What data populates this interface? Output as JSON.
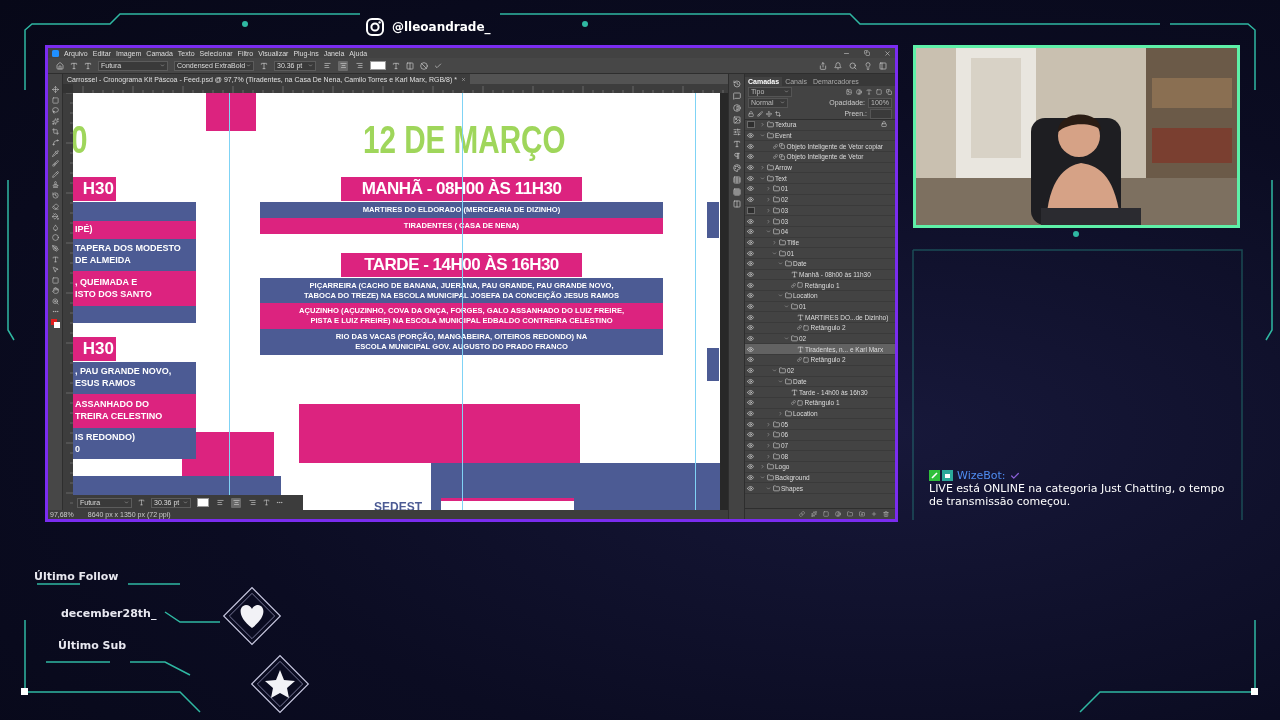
{
  "overlay": {
    "handle": "@lleoandrade_",
    "last_follow_label": "Último Follow",
    "last_follow": "december28th_",
    "last_sub_label": "Último Sub"
  },
  "photoshop": {
    "menu": [
      "Arquivo",
      "Editar",
      "Imagem",
      "Camada",
      "Texto",
      "Selecionar",
      "Filtro",
      "Visualizar",
      "Plug-ins",
      "Janela",
      "Ajuda"
    ],
    "options": {
      "font": "Futura",
      "style": "Condensed ExtraBold",
      "size": "30.36 pt",
      "alignment": [
        {
          "kind": "left",
          "selected": false
        },
        {
          "kind": "center",
          "selected": true
        },
        {
          "kind": "right",
          "selected": false
        }
      ]
    },
    "document_tab": "Carrossel - Cronograma Kit Páscoa - Feed.psd @ 97,7% (Tiradentes, na Casa De Nena, Camilo Torres e Karl Marx, RGB/8) *",
    "text_toolbar": {
      "font": "Futura",
      "size": "30.36 pt",
      "alignment": [
        {
          "kind": "left",
          "selected": false
        },
        {
          "kind": "center",
          "selected": true
        },
        {
          "kind": "right",
          "selected": false
        }
      ]
    },
    "status": {
      "zoom": "97,68%",
      "size": "8640 px x 1350 px (72 ppi)"
    },
    "panel_tabs": [
      {
        "label": "Camadas",
        "selected": true
      },
      {
        "label": "Canais",
        "selected": false
      },
      {
        "label": "Demarcadores",
        "selected": false
      }
    ],
    "layer_filter": "Tipo",
    "blend_mode": "Normal",
    "opacity_label": "Opacidade:",
    "opacity": "100%",
    "fill_label": "Preen.:",
    "layers": [
      {
        "name": "Textura",
        "kind": "folder",
        "visible": false,
        "locked": true,
        "selected": false,
        "expanded": false
      },
      {
        "name": "Event",
        "kind": "folder",
        "visible": true,
        "locked": false,
        "selected": false,
        "expanded": true,
        "children": [
          {
            "name": "Objeto Inteligente de Vetor copiar",
            "kind": "smart",
            "visible": true,
            "locked": false,
            "selected": false
          },
          {
            "name": "Objeto Inteligente de Vetor",
            "kind": "smart",
            "visible": true,
            "locked": false,
            "selected": false
          }
        ]
      },
      {
        "name": "Arrow",
        "kind": "folder",
        "visible": true,
        "locked": false,
        "selected": false,
        "expanded": false
      },
      {
        "name": "Text",
        "kind": "folder",
        "visible": true,
        "locked": false,
        "selected": false,
        "expanded": true,
        "children": [
          {
            "name": "01",
            "kind": "folder",
            "visible": true,
            "locked": false,
            "selected": false,
            "expanded": false
          },
          {
            "name": "02",
            "kind": "folder",
            "visible": true,
            "locked": false,
            "selected": false,
            "expanded": false
          },
          {
            "name": "03",
            "kind": "folder",
            "visible": false,
            "locked": false,
            "selected": false,
            "expanded": false
          },
          {
            "name": "03",
            "kind": "folder",
            "visible": true,
            "locked": false,
            "selected": false,
            "expanded": false
          },
          {
            "name": "04",
            "kind": "folder",
            "visible": true,
            "locked": false,
            "selected": false,
            "expanded": true,
            "children": [
              {
                "name": "Title",
                "kind": "folder",
                "visible": true,
                "locked": false,
                "selected": false,
                "expanded": false
              },
              {
                "name": "01",
                "kind": "folder",
                "visible": true,
                "locked": false,
                "selected": false,
                "expanded": true,
                "children": [
                  {
                    "name": "Date",
                    "kind": "folder",
                    "visible": true,
                    "locked": false,
                    "selected": false,
                    "expanded": true,
                    "children": [
                      {
                        "name": "Manhã - 08h00 às 11h30",
                        "kind": "text",
                        "visible": true,
                        "locked": false,
                        "selected": false
                      },
                      {
                        "name": "Retângulo 1",
                        "kind": "shape",
                        "visible": true,
                        "locked": false,
                        "selected": false
                      }
                    ]
                  },
                  {
                    "name": "Location",
                    "kind": "folder",
                    "visible": true,
                    "locked": false,
                    "selected": false,
                    "expanded": true,
                    "children": [
                      {
                        "name": "01",
                        "kind": "folder",
                        "visible": true,
                        "locked": false,
                        "selected": false,
                        "expanded": true,
                        "children": [
                          {
                            "name": "MARTIRES DO...de Dizinho)",
                            "kind": "text",
                            "visible": true,
                            "locked": false,
                            "selected": false
                          },
                          {
                            "name": "Retângulo 2",
                            "kind": "shape",
                            "visible": true,
                            "locked": false,
                            "selected": false
                          }
                        ]
                      },
                      {
                        "name": "02",
                        "kind": "folder",
                        "visible": true,
                        "locked": false,
                        "selected": false,
                        "expanded": true,
                        "children": [
                          {
                            "name": "Tiradentes, n... e Karl Marx",
                            "kind": "text",
                            "visible": true,
                            "locked": false,
                            "selected": true
                          },
                          {
                            "name": "Retângulo 2",
                            "kind": "shape",
                            "visible": true,
                            "locked": false,
                            "selected": false
                          }
                        ]
                      }
                    ]
                  }
                ]
              },
              {
                "name": "02",
                "kind": "folder",
                "visible": true,
                "locked": false,
                "selected": false,
                "expanded": true,
                "children": [
                  {
                    "name": "Date",
                    "kind": "folder",
                    "visible": true,
                    "locked": false,
                    "selected": false,
                    "expanded": true,
                    "children": [
                      {
                        "name": "Tarde - 14h00 às 16h30",
                        "kind": "text",
                        "visible": true,
                        "locked": false,
                        "selected": false
                      },
                      {
                        "name": "Retângulo 1",
                        "kind": "shape",
                        "visible": true,
                        "locked": false,
                        "selected": false
                      }
                    ]
                  },
                  {
                    "name": "Location",
                    "kind": "folder",
                    "visible": true,
                    "locked": false,
                    "selected": false,
                    "expanded": false
                  }
                ]
              }
            ]
          },
          {
            "name": "05",
            "kind": "folder",
            "visible": true,
            "locked": false,
            "selected": false,
            "expanded": false
          },
          {
            "name": "06",
            "kind": "folder",
            "visible": true,
            "locked": false,
            "selected": false,
            "expanded": false
          },
          {
            "name": "07",
            "kind": "folder",
            "visible": true,
            "locked": false,
            "selected": false,
            "expanded": false
          },
          {
            "name": "08",
            "kind": "folder",
            "visible": true,
            "locked": false,
            "selected": false,
            "expanded": false
          }
        ]
      },
      {
        "name": "Logo",
        "kind": "folder",
        "visible": true,
        "locked": false,
        "selected": false,
        "expanded": false
      },
      {
        "name": "Background",
        "kind": "folder",
        "visible": true,
        "locked": false,
        "selected": false,
        "expanded": true,
        "children": [
          {
            "name": "Shapes",
            "kind": "folder",
            "visible": true,
            "locked": false,
            "selected": false,
            "expanded": true
          }
        ]
      }
    ]
  },
  "artboard": {
    "side_title": "0",
    "date_title": "12 DE MARÇO",
    "periods": [
      {
        "title": "MANHÃ - 08H00 ÀS 11H30",
        "locations": [
          {
            "lines": [
              "MARTIRES DO ELDORADO (MERCEARIA DE DIZINHO)"
            ],
            "color": "#4c5b94"
          },
          {
            "lines": [
              "TIRADENTES ( CASA DE NENA)"
            ],
            "color": "#dc237f"
          }
        ]
      },
      {
        "title": "TARDE - 14H00 ÀS 16H30",
        "locations": [
          {
            "lines": [
              "PIÇARREIRA (CACHO DE BANANA, JUERANA, PAU GRANDE, PAU GRANDE NOVO,",
              "TABOCA DO TREZE) NA ESCOLA MUNICIPAL JOSEFA DA CONCEIÇÃO JESUS RAMOS"
            ],
            "color": "#4c5b94"
          },
          {
            "lines": [
              "AÇUZINHO (AÇUZINHO, COVA DA ONÇA, FORGES, GALO ASSANHADO DO LUIZ FREIRE,",
              "PISTA E LUIZ FREIRE) NA ESCOLA MUNICIPAL EDBALDO CONTREIRA CELESTINO"
            ],
            "color": "#dc237f"
          },
          {
            "lines": [
              "RIO DAS VACAS (PORÇÃO, MANGABEIRA, OITEIROS REDONDO) NA",
              "ESCOLA MUNICIPAL  GOV. AUGUSTO DO PRADO FRANCO"
            ],
            "color": "#4c5b94"
          }
        ]
      }
    ],
    "left_blocks": [
      {
        "kind": "header",
        "lines": [
          "H30"
        ],
        "color": "#dc237f"
      },
      {
        "kind": "row",
        "lines": [
          "IPÉ)"
        ],
        "color": "#dc237f"
      },
      {
        "kind": "row",
        "lines": [
          "TAPERA DOS MODESTO",
          "DE ALMEIDA"
        ],
        "color": "#4c5b94"
      },
      {
        "kind": "row",
        "lines": [
          ", QUEIMADA E",
          "ISTO DOS SANTO"
        ],
        "color": "#dc237f"
      },
      {
        "kind": "header",
        "lines": [
          "H30"
        ],
        "color": "#dc237f"
      },
      {
        "kind": "row",
        "lines": [
          ", PAU GRANDE NOVO,",
          "ESUS RAMOS"
        ],
        "color": "#4c5b94"
      },
      {
        "kind": "row",
        "lines": [
          "ASSANHADO DO",
          "TREIRA CELESTINO"
        ],
        "color": "#dc237f"
      },
      {
        "kind": "row",
        "lines": [
          "IS REDONDO)",
          "0"
        ],
        "color": "#4c5b94"
      }
    ],
    "logo_text": "SEDEST"
  },
  "chat": {
    "user": "WizeBot:",
    "message": "LIVE está ONLINE na categoria Just Chatting, o tempo de transmissão começou."
  }
}
